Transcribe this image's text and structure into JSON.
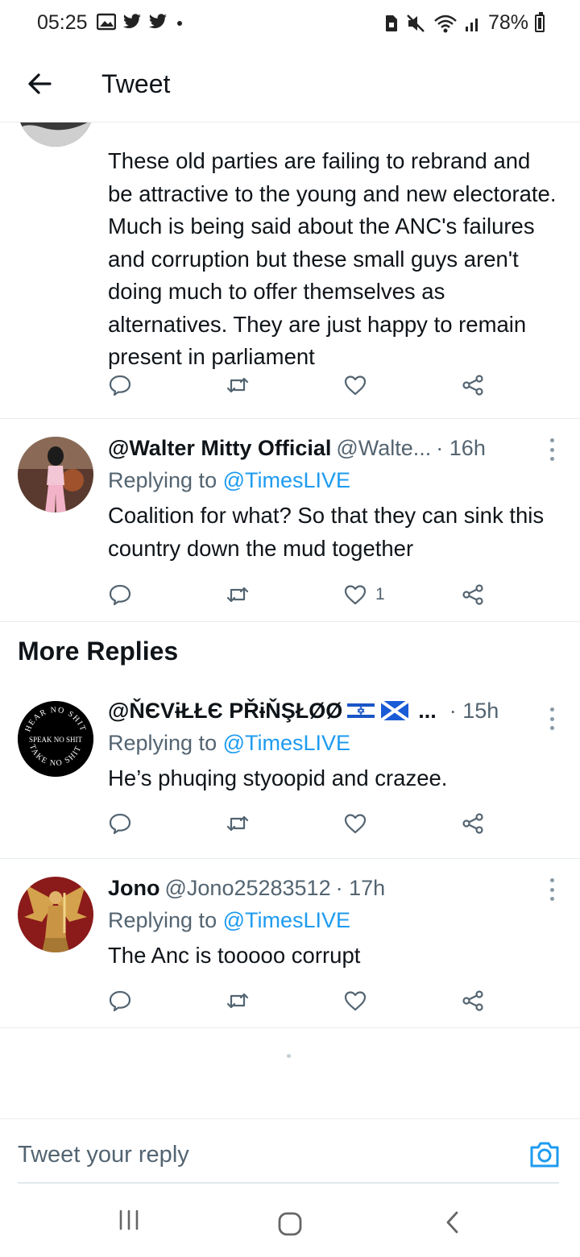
{
  "status_bar": {
    "time": "05:25",
    "left_icons": [
      "gallery-icon",
      "twitter-icon",
      "twitter-icon",
      "dot-icon"
    ],
    "right_icons": [
      "sim-icon",
      "mute-icon",
      "wifi-icon",
      "signal-icon"
    ],
    "battery": "78%"
  },
  "header": {
    "back_icon": "arrow-left-icon",
    "title": "Tweet"
  },
  "tweets": [
    {
      "text": "These old parties are failing to rebrand and be attractive to the young and new electorate. Much is being said about the ANC's failures and corruption but these small guys aren't doing much to offer themselves as alternatives. They are just happy to remain present in parliament",
      "likes": ""
    },
    {
      "author": "@Walter Mitty Official",
      "handle": "@Walte...",
      "time": "· 16h",
      "replying_prefix": "Replying to",
      "replying_to": "@TimesLIVE",
      "text": "Coalition for what? So that they can sink this country down the mud together",
      "likes": "1"
    },
    {
      "author": "@ŇЄVɨŁŁЄ PŘɨŇŞŁØØ",
      "handle": "...",
      "time": "· 15h",
      "replying_prefix": "Replying to",
      "replying_to": "@TimesLIVE",
      "text": "He’s phuqing styoopid and crazee.",
      "likes": "",
      "avatar_text": "SPEAK NO SHIT",
      "avatar_top_text": "HEAR NO SHIT",
      "avatar_bottom_text": "TAKE NO SHIT"
    },
    {
      "author": "Jono",
      "handle": "@Jono25283512",
      "time": "· 17h",
      "replying_prefix": "Replying to",
      "replying_to": "@TimesLIVE",
      "text": "The Anc is tooooo corrupt",
      "likes": ""
    }
  ],
  "sections": {
    "more_replies": "More Replies"
  },
  "composer": {
    "placeholder": "Tweet your reply",
    "camera_icon": "camera-icon"
  },
  "nav": {
    "recents": "recents-icon",
    "home": "home-icon",
    "back": "back-icon"
  },
  "colors": {
    "accent": "#1d9bf0",
    "secondary_text": "#536471",
    "divider": "#e6ecf0"
  }
}
